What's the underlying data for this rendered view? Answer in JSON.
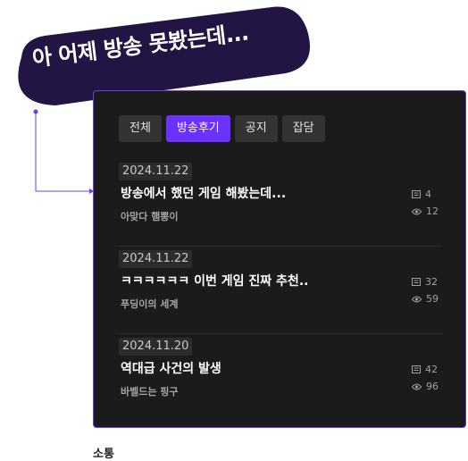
{
  "bubble": {
    "text": "아 어제 방송 못봤는데..."
  },
  "colors": {
    "accent": "#6a31ff",
    "bubble": "#221544",
    "panel": "#1b1b1c",
    "border": "#6a3de8"
  },
  "tabs": [
    {
      "label": "전체",
      "active": false
    },
    {
      "label": "방송후기",
      "active": true
    },
    {
      "label": "공지",
      "active": false
    },
    {
      "label": "잡담",
      "active": false
    }
  ],
  "posts": [
    {
      "date": "2024.11.22",
      "title": "방송에서 했던 게임 해봤는데...",
      "author": "아맞다 햄뽕이",
      "comments": "4",
      "views": "12"
    },
    {
      "date": "2024.11.22",
      "title": "ㅋㅋㅋㅋㅋㅋ 이번 게임 진짜 추천..",
      "author": "푸딩이의 세계",
      "comments": "32",
      "views": "59"
    },
    {
      "date": "2024.11.20",
      "title": "역대급 사건의 발생",
      "author": "바벨드는 핑구",
      "comments": "42",
      "views": "96"
    }
  ],
  "icons": {
    "comments": "comment-icon",
    "views": "eye-icon"
  },
  "footer": {
    "label": "소통"
  }
}
